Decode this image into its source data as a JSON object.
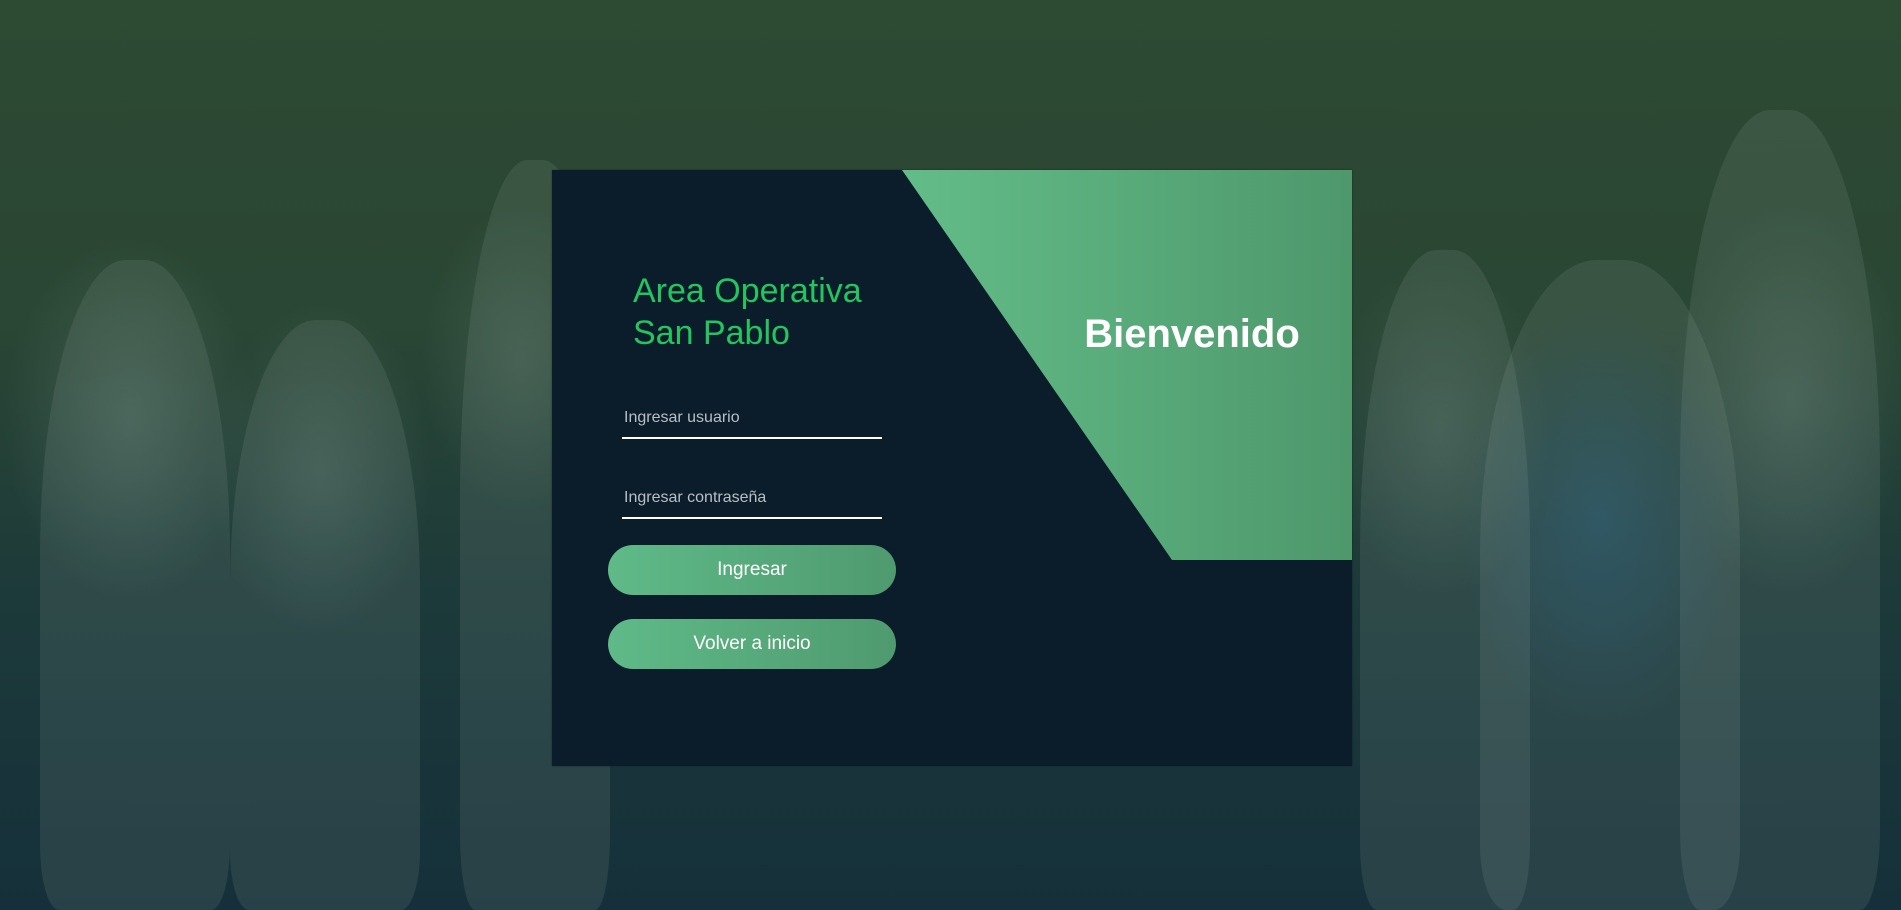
{
  "brand": {
    "line1": "Area Operativa",
    "line2": "San Pablo"
  },
  "welcome": "Bienvenido",
  "form": {
    "username_placeholder": "Ingresar usuario",
    "password_placeholder": "Ingresar contraseña",
    "login_label": "Ingresar",
    "home_label": "Volver a inicio"
  },
  "colors": {
    "card": "#0b1d2b",
    "accent": "#22c55e",
    "panel_green": "#5fba88",
    "panel_green_dark": "#4f9a6f"
  }
}
